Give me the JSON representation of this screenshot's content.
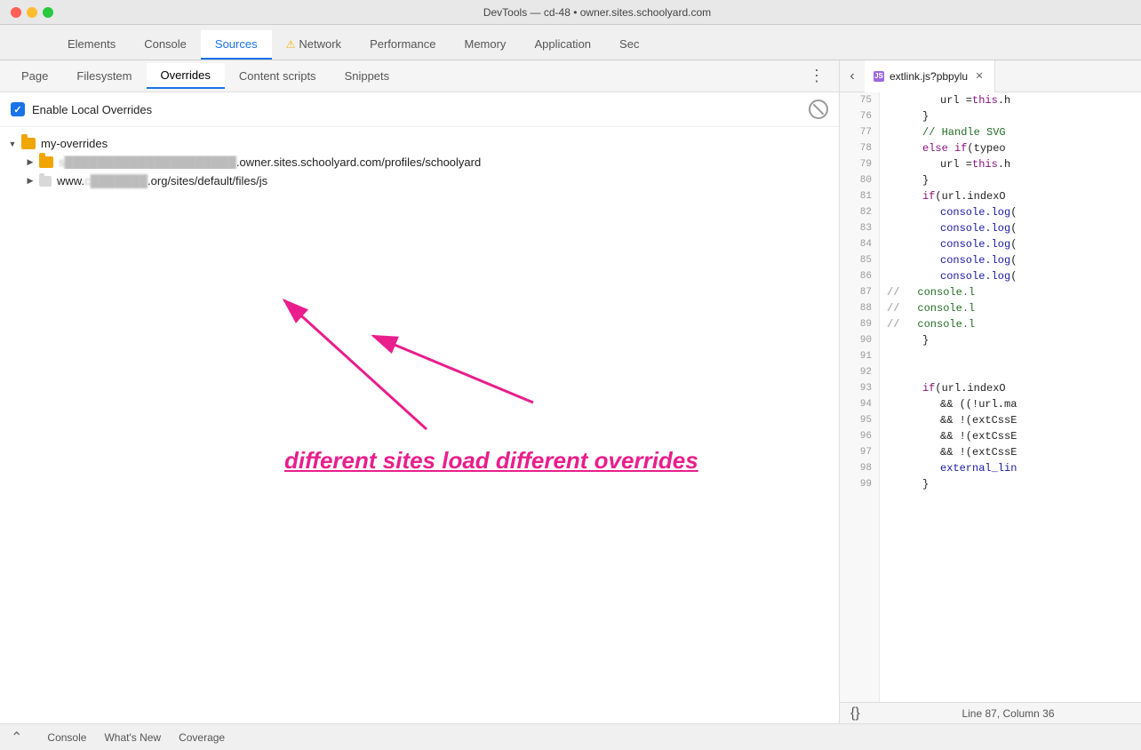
{
  "titlebar": {
    "title": "DevTools — cd-48 • owner.sites.schoolyard.com"
  },
  "main_tabs": [
    {
      "label": "Elements",
      "active": false
    },
    {
      "label": "Console",
      "active": false
    },
    {
      "label": "Sources",
      "active": true
    },
    {
      "label": "Network",
      "active": false,
      "warning": true
    },
    {
      "label": "Performance",
      "active": false
    },
    {
      "label": "Memory",
      "active": false
    },
    {
      "label": "Application",
      "active": false
    },
    {
      "label": "Sec",
      "active": false
    }
  ],
  "secondary_tabs": [
    {
      "label": "Page",
      "active": false
    },
    {
      "label": "Filesystem",
      "active": false
    },
    {
      "label": "Overrides",
      "active": true
    },
    {
      "label": "Content scripts",
      "active": false
    },
    {
      "label": "Snippets",
      "active": false
    }
  ],
  "enable_overrides": {
    "label": "Enable Local Overrides"
  },
  "file_tree": {
    "root": {
      "name": "my-overrides",
      "expanded": true
    },
    "items": [
      {
        "label": "s█████.owner.sites.schoolyard.com/profiles/schoolyard",
        "label_visible": "s███████.owner.sites.schoolyard.com/profiles/schoolyard",
        "blurred_prefix": "s█████",
        "full": ".owner.sites.schoolyard.com/profiles/schoolyard",
        "type": "folder"
      },
      {
        "label": "www.c█████.org/sites/default/files/js",
        "type": "folder"
      }
    ]
  },
  "annotation": {
    "text": "different sites load different overrides"
  },
  "editor": {
    "tab_label": "extlink.js?pbpylu",
    "lines": [
      {
        "num": 75,
        "content": "url = this.h",
        "indent": 3,
        "parts": [
          {
            "type": "prop",
            "text": "            url = "
          },
          {
            "type": "kw",
            "text": "this"
          },
          {
            "type": "prop",
            "text": ".h"
          }
        ]
      },
      {
        "num": 76,
        "content": "}",
        "indent": 2,
        "parts": [
          {
            "type": "prop",
            "text": "        }"
          }
        ]
      },
      {
        "num": 77,
        "content": "// Handle SVG",
        "parts": [
          {
            "type": "cm",
            "text": "        // Handle SVG"
          }
        ]
      },
      {
        "num": 78,
        "content": "else if (typeo",
        "parts": [
          {
            "type": "kw",
            "text": "        else if"
          },
          {
            "type": "prop",
            "text": " (typeo"
          }
        ]
      },
      {
        "num": 79,
        "content": "url = this.h",
        "parts": [
          {
            "type": "prop",
            "text": "            url = "
          },
          {
            "type": "kw",
            "text": "this"
          },
          {
            "type": "prop",
            "text": ".h"
          }
        ]
      },
      {
        "num": 80,
        "content": "}",
        "parts": [
          {
            "type": "prop",
            "text": "        }"
          }
        ]
      },
      {
        "num": 81,
        "content": "if (url.indexO",
        "parts": [
          {
            "type": "kw",
            "text": "        if"
          },
          {
            "type": "prop",
            "text": " (url.indexO"
          }
        ]
      },
      {
        "num": 82,
        "content": "console.log(",
        "parts": [
          {
            "type": "prop",
            "text": "            "
          },
          {
            "type": "fn",
            "text": "console.log"
          },
          {
            "type": "prop",
            "text": "("
          }
        ]
      },
      {
        "num": 83,
        "content": "console.log(",
        "parts": [
          {
            "type": "prop",
            "text": "            "
          },
          {
            "type": "fn",
            "text": "console.log"
          },
          {
            "type": "prop",
            "text": "("
          }
        ]
      },
      {
        "num": 84,
        "content": "console.log(",
        "parts": [
          {
            "type": "prop",
            "text": "            "
          },
          {
            "type": "fn",
            "text": "console.log"
          },
          {
            "type": "prop",
            "text": "("
          }
        ]
      },
      {
        "num": 85,
        "content": "console.log(",
        "parts": [
          {
            "type": "prop",
            "text": "            "
          },
          {
            "type": "fn",
            "text": "console.log"
          },
          {
            "type": "prop",
            "text": "("
          }
        ]
      },
      {
        "num": 86,
        "content": "console.log(",
        "parts": [
          {
            "type": "prop",
            "text": "            "
          },
          {
            "type": "fn",
            "text": "console.log"
          },
          {
            "type": "prop",
            "text": "("
          }
        ]
      },
      {
        "num": 87,
        "content": "//       console.l",
        "parts": [
          {
            "type": "cm-gray",
            "text": "// "
          },
          {
            "type": "cm",
            "text": "            console.l"
          }
        ]
      },
      {
        "num": 88,
        "content": "//       console.l",
        "parts": [
          {
            "type": "cm-gray",
            "text": "// "
          },
          {
            "type": "cm",
            "text": "            console.l"
          }
        ]
      },
      {
        "num": 89,
        "content": "//       console.l",
        "parts": [
          {
            "type": "cm-gray",
            "text": "// "
          },
          {
            "type": "cm",
            "text": "            console.l"
          }
        ]
      },
      {
        "num": 90,
        "content": "}",
        "parts": [
          {
            "type": "prop",
            "text": "        }"
          }
        ]
      },
      {
        "num": 91,
        "content": "",
        "parts": []
      },
      {
        "num": 92,
        "content": "",
        "parts": []
      },
      {
        "num": 93,
        "content": "if (url.indexO",
        "parts": [
          {
            "type": "kw",
            "text": "        if"
          },
          {
            "type": "prop",
            "text": " (url.indexO"
          }
        ]
      },
      {
        "num": 94,
        "content": "&& ((!url.ma",
        "parts": [
          {
            "type": "prop",
            "text": "            && ((!url.ma"
          }
        ]
      },
      {
        "num": 95,
        "content": "&& !(extCssE",
        "parts": [
          {
            "type": "prop",
            "text": "            && !(extCssE"
          }
        ]
      },
      {
        "num": 96,
        "content": "&& !(extCssE",
        "parts": [
          {
            "type": "prop",
            "text": "            && !(extCssE"
          }
        ]
      },
      {
        "num": 97,
        "content": "&& !(extCssE",
        "parts": [
          {
            "type": "prop",
            "text": "            && !(extCssE"
          }
        ]
      },
      {
        "num": 98,
        "content": "external_lin",
        "parts": [
          {
            "type": "fn",
            "text": "            external_lin"
          }
        ]
      },
      {
        "num": 99,
        "content": "}",
        "parts": [
          {
            "type": "prop",
            "text": "        }"
          }
        ]
      }
    ]
  },
  "status_bar": {
    "left_icon": "{}",
    "text": "Line 87, Column 36"
  },
  "bottom_tabs": [
    {
      "label": "Console",
      "active": false
    },
    {
      "label": "What's New",
      "active": false
    },
    {
      "label": "Coverage",
      "active": false
    }
  ],
  "url_annotations": [
    {
      "text": "url this",
      "position": "top-right"
    },
    {
      "text": "url this",
      "position": "mid-right"
    }
  ]
}
